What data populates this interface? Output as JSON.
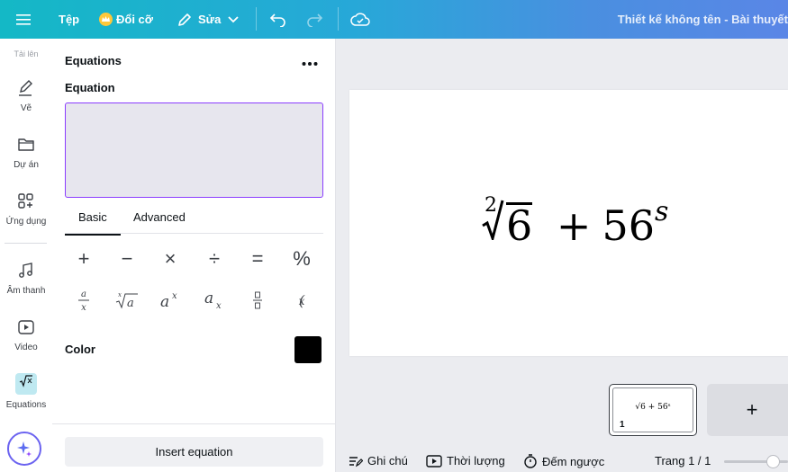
{
  "topbar": {
    "menu_icon": "hamburger-icon",
    "file_label": "Tệp",
    "resize_label": "Đổi cỡ",
    "edit_label": "Sửa",
    "design_title": "Thiết kế không tên - Bài thuyết"
  },
  "rail": {
    "items": [
      {
        "label": "Tải lên",
        "icon": "upload-icon"
      },
      {
        "label": "Vẽ",
        "icon": "draw-icon"
      },
      {
        "label": "Dự án",
        "icon": "folder-icon"
      },
      {
        "label": "Ứng dụng",
        "icon": "apps-icon"
      },
      {
        "label": "Âm thanh",
        "icon": "music-icon"
      },
      {
        "label": "Video",
        "icon": "video-icon"
      },
      {
        "label": "Equations",
        "icon": "sqrt-icon"
      }
    ]
  },
  "panel": {
    "title": "Equations",
    "more_icon": "more-icon",
    "equation_label": "Equation",
    "equation_value": "",
    "tabs": [
      "Basic",
      "Advanced"
    ],
    "active_tab": "Basic",
    "symbols_row1": [
      "+",
      "−",
      "×",
      "÷",
      "=",
      "%"
    ],
    "color_label": "Color",
    "color_value": "#000000",
    "insert_label": "Insert equation"
  },
  "canvas": {
    "equation_render": {
      "root_index": "2",
      "radicand": "6",
      "operator": "+",
      "base": "56",
      "exponent": "s"
    },
    "thumbnail_equation": "√6 + 56ˢ",
    "thumbnail_page_number": "1",
    "add_page": "+"
  },
  "bottom": {
    "notes_label": "Ghi chú",
    "duration_label": "Thời lượng",
    "timer_label": "Đếm ngược",
    "page_counter": "Trang 1 / 1"
  },
  "colors": {
    "accent": "#8b3dff",
    "gradient_start": "#14b8c6",
    "gradient_end": "#5a86e6",
    "text": "#0d1216"
  }
}
